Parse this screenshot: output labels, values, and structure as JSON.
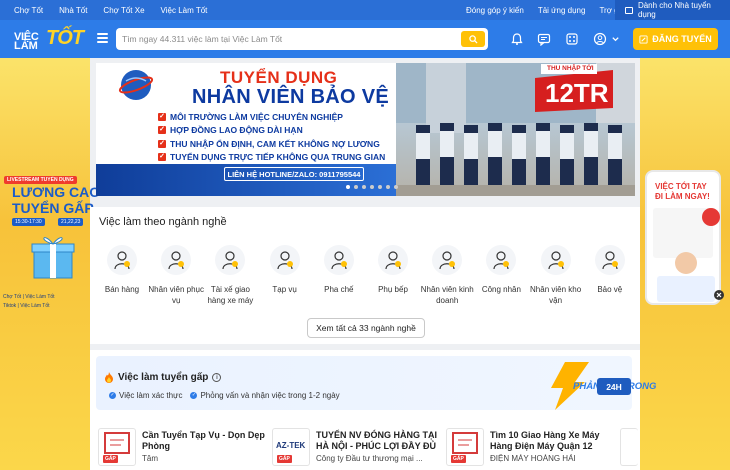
{
  "topbar": {
    "links": [
      "Chợ Tốt",
      "Nhà Tốt",
      "Chợ Tốt Xe",
      "Việc Làm Tốt"
    ],
    "right_links": [
      "Đóng góp ý kiến",
      "Tải ứng dụng",
      "Trợ giúp"
    ],
    "employer": "Dành cho Nhà tuyển dụng"
  },
  "header": {
    "logo_line1": "VIỆC",
    "logo_line2": "LÀM",
    "logo_brand": "TỐT",
    "search_placeholder": "Tìm ngay 44.311 việc làm tại Việc Làm Tốt",
    "post_button": "ĐĂNG TUYỂN"
  },
  "hero": {
    "title1": "TUYỂN DỤNG",
    "title2": "NHÂN VIÊN BẢO VỆ",
    "bullets": [
      "MÔI TRƯỜNG LÀM VIỆC CHUYÊN NGHIỆP",
      "HỢP ĐỒNG LAO ĐỘNG DÀI HẠN",
      "THU NHẬP ỔN ĐỊNH, CAM KẾT KHÔNG NỢ LƯƠNG",
      "TUYỂN DỤNG TRỰC TIẾP KHÔNG QUA TRUNG GIAN"
    ],
    "hotline": "LIÊN HỆ HOTLINE/ZALO: 0911795544",
    "salary_label": "THU NHẬP TỚI",
    "salary_value": "12TR"
  },
  "left_ad": {
    "live": "LIVESTREAM TUYỂN DỤNG",
    "line1": "LƯƠNG CAO",
    "line2": "TUYỂN GẤP",
    "time": "15:30-17:30",
    "dates": "21,22,23",
    "src1": "Chợ Tốt | Việc Làm Tốt",
    "src2": "Tiktok | Việc Làm Tốt"
  },
  "right_ad": {
    "line1": "VIỆC TỚI TAY",
    "line2": "ĐI LÀM NGAY!"
  },
  "categories": {
    "title": "Việc làm theo ngành nghề",
    "items": [
      {
        "label": "Bán hàng",
        "icon": "sales-person-icon"
      },
      {
        "label": "Nhân viên phục vụ",
        "icon": "waiter-icon"
      },
      {
        "label": "Tài xế giao hàng xe máy",
        "icon": "delivery-rider-icon"
      },
      {
        "label": "Tạp vụ",
        "icon": "cleaner-icon"
      },
      {
        "label": "Pha chế",
        "icon": "bartender-icon"
      },
      {
        "label": "Phụ bếp",
        "icon": "kitchen-helper-icon"
      },
      {
        "label": "Nhân viên kinh doanh",
        "icon": "business-person-icon"
      },
      {
        "label": "Công nhân",
        "icon": "worker-icon"
      },
      {
        "label": "Nhân viên kho vận",
        "icon": "warehouse-icon"
      },
      {
        "label": "Bảo vệ",
        "icon": "security-guard-icon"
      }
    ],
    "see_all": "Xem tất cả 33 ngành nghề"
  },
  "urgent": {
    "title": "Việc làm tuyển gấp",
    "checks": [
      "Việc làm xác thực",
      "Phỏng vấn và nhận việc trong 1-2 ngày"
    ],
    "reply_label": "PHẢN HỒI TRONG",
    "reply_hours": "24H"
  },
  "jobs": [
    {
      "title": "Cần Tuyển Tạp Vụ - Dọn Dẹp Phòng",
      "company": "Tâm",
      "badge": "GẤP",
      "logo": ""
    },
    {
      "title": "TUYỂN NV ĐÓNG HÀNG TẠI HÀ NỘI - PHÚC LỢI ĐẦY ĐỦ",
      "company": "Công ty Đầu tư thương mại ...",
      "badge": "GẤP",
      "logo": "AZ-TEK"
    },
    {
      "title": "Tìm 10 Giao Hàng Xe Máy Hàng Điện Máy Quận 12",
      "company": "ĐIỆN MÁY HOÀNG HẢI",
      "badge": "GẤP",
      "logo": ""
    }
  ],
  "colors": {
    "topbar": "#2b6fd6",
    "header": "#2d7ce8",
    "accent": "#ffc107",
    "urgent_red": "#e53935"
  }
}
